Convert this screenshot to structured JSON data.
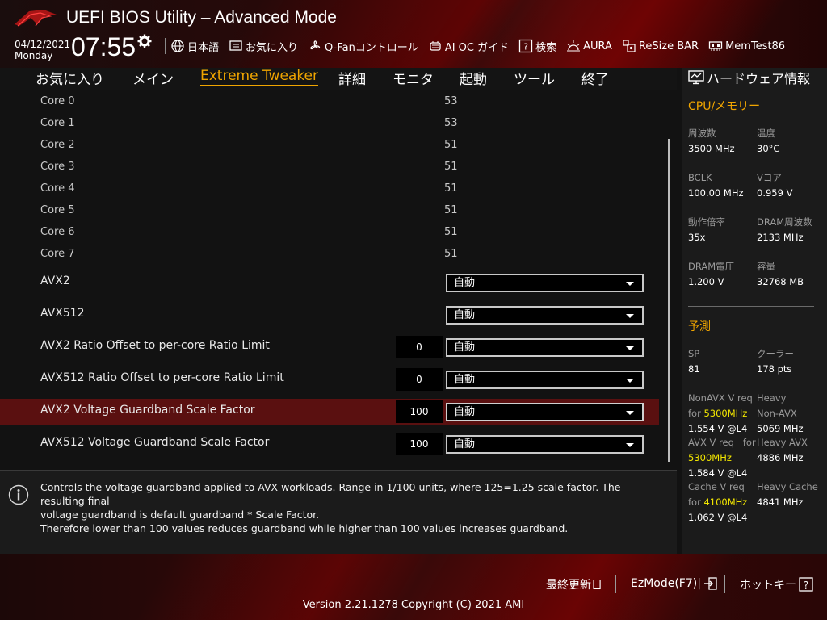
{
  "header": {
    "title": "UEFI BIOS Utility – Advanced Mode",
    "date": "04/12/2021",
    "day": "Monday",
    "time": "07:55",
    "toolbar": [
      {
        "label": "日本語",
        "icon": "globe-icon"
      },
      {
        "label": "お気に入り",
        "icon": "favorites-icon"
      },
      {
        "label": "Q-Fanコントロール",
        "icon": "fan-icon"
      },
      {
        "label": "AI OC ガイド",
        "icon": "ai-oc-icon"
      },
      {
        "label": "検索",
        "icon": "search-help-icon"
      },
      {
        "label": "AURA",
        "icon": "aura-icon"
      },
      {
        "label": "ReSize BAR",
        "icon": "resize-bar-icon"
      },
      {
        "label": "MemTest86",
        "icon": "memtest-icon"
      }
    ]
  },
  "nav": {
    "tabs": [
      {
        "label": "お気に入り"
      },
      {
        "label": "メイン"
      },
      {
        "label": "Extreme Tweaker",
        "active": true
      },
      {
        "label": "詳細"
      },
      {
        "label": "モニタ"
      },
      {
        "label": "起動"
      },
      {
        "label": "ツール"
      },
      {
        "label": "終了"
      }
    ]
  },
  "settings": {
    "cores": [
      {
        "label": "Core 0",
        "value": "53"
      },
      {
        "label": "Core 1",
        "value": "53"
      },
      {
        "label": "Core 2",
        "value": "51"
      },
      {
        "label": "Core 3",
        "value": "51"
      },
      {
        "label": "Core 4",
        "value": "51"
      },
      {
        "label": "Core 5",
        "value": "51"
      },
      {
        "label": "Core 6",
        "value": "51"
      },
      {
        "label": "Core 7",
        "value": "51"
      }
    ],
    "items": [
      {
        "label": "AVX2",
        "value": "",
        "option": "自動"
      },
      {
        "label": "AVX512",
        "value": "",
        "option": "自動"
      },
      {
        "label": "AVX2 Ratio Offset to per-core Ratio Limit",
        "value": "0",
        "option": "自動"
      },
      {
        "label": "AVX512 Ratio Offset to per-core Ratio Limit",
        "value": "0",
        "option": "自動"
      },
      {
        "label": "AVX2 Voltage Guardband Scale Factor",
        "value": "100",
        "option": "自動",
        "selected": true
      },
      {
        "label": "AVX512 Voltage Guardband Scale Factor",
        "value": "100",
        "option": "自動"
      }
    ]
  },
  "help": {
    "lines": [
      "Controls the voltage guardband applied to AVX workloads. Range in 1/100 units, where 125=1.25 scale factor. The resulting final",
      "voltage guardband is default guardband * Scale Factor.",
      "Therefore lower than 100 values reduces guardband while higher than 100 values increases guardband."
    ]
  },
  "hw": {
    "title": "ハードウェア情報",
    "cpu_section": "CPU/メモリー",
    "cpu": [
      {
        "k": "周波数",
        "v": "3500 MHz"
      },
      {
        "k": "温度",
        "v": "30°C"
      },
      {
        "k": "BCLK",
        "v": "100.00 MHz"
      },
      {
        "k": "Vコア",
        "v": "0.959 V"
      },
      {
        "k": "動作倍率",
        "v": "35x"
      },
      {
        "k": "DRAM周波数",
        "v": "2133 MHz"
      },
      {
        "k": "DRAM電圧",
        "v": "1.200 V"
      },
      {
        "k": "容量",
        "v": "32768 MB"
      }
    ],
    "predict_section": "予測",
    "sp": {
      "k": "SP",
      "v": "81"
    },
    "cooler": {
      "k": "クーラー",
      "v": "178 pts"
    },
    "nonavx": {
      "k1": "NonAVX V req",
      "k2": "for",
      "freq": "5300MHz",
      "v": "1.554 V @L4"
    },
    "heavy_nonavx": {
      "k1": "Heavy",
      "k2": "Non-AVX",
      "v": "5069 MHz"
    },
    "avx": {
      "k1": "AVX V req",
      "k2": "for",
      "freq": "5300MHz",
      "v": "1.584 V @L4"
    },
    "heavy_avx": {
      "k1": "Heavy AVX",
      "v": "4886 MHz"
    },
    "cache": {
      "k1": "Cache V req",
      "k2": "for",
      "freq": "4100MHz",
      "v": "1.062 V @L4"
    },
    "heavy_cache": {
      "k1": "Heavy Cache",
      "v": "4841 MHz"
    }
  },
  "footer": {
    "last_modified": "最終更新日",
    "ezmode": "EzMode(F7)|",
    "hotkeys": "ホットキー",
    "hotkey_glyph": "?",
    "version": "Version 2.21.1278 Copyright (C) 2021 AMI"
  }
}
